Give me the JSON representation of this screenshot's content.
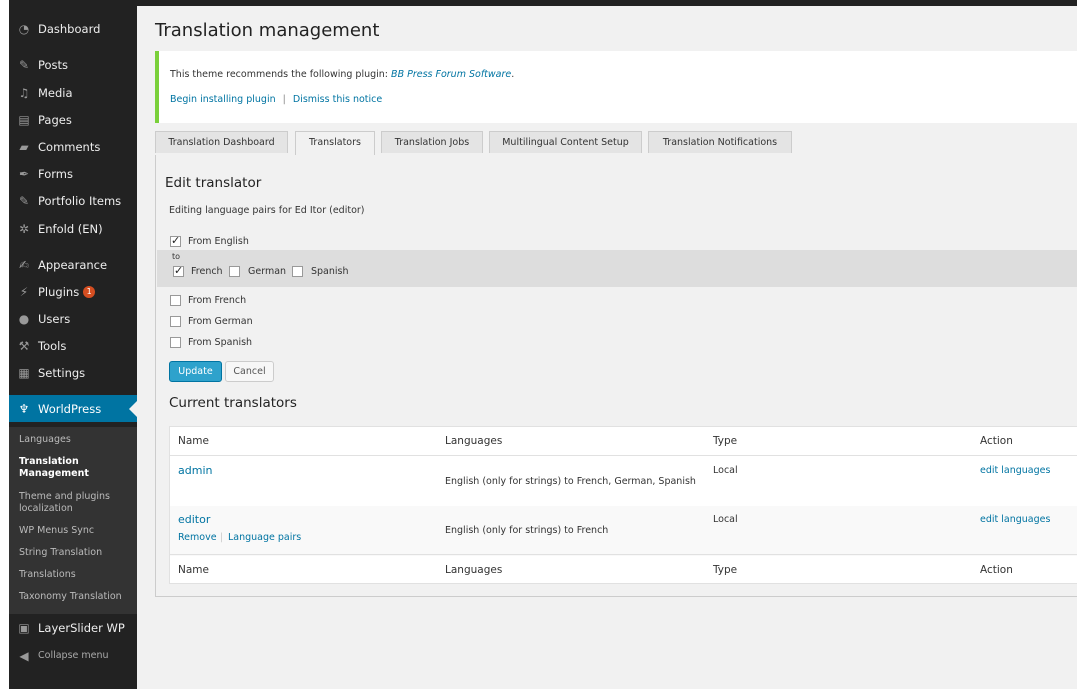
{
  "sidebar": {
    "items": [
      {
        "label": "Dashboard",
        "icon": "dashboard-icon"
      },
      {
        "label": "Posts",
        "icon": "pin-icon"
      },
      {
        "label": "Media",
        "icon": "media-icon"
      },
      {
        "label": "Pages",
        "icon": "pages-icon"
      },
      {
        "label": "Comments",
        "icon": "comment-icon"
      },
      {
        "label": "Forms",
        "icon": "feather-icon"
      },
      {
        "label": "Portfolio Items",
        "icon": "pin-icon"
      },
      {
        "label": "Enfold (EN)",
        "icon": "gear-icon"
      },
      {
        "label": "Appearance",
        "icon": "brush-icon"
      },
      {
        "label": "Plugins",
        "icon": "plug-icon",
        "badge": "1"
      },
      {
        "label": "Users",
        "icon": "user-icon"
      },
      {
        "label": "Tools",
        "icon": "wrench-icon"
      },
      {
        "label": "Settings",
        "icon": "settings-icon"
      },
      {
        "label": "WorldPress",
        "icon": "wpml-icon"
      }
    ],
    "submenu": [
      "Languages",
      "Translation Management",
      "Theme and plugins localization",
      "WP Menus Sync",
      "String Translation",
      "Translations",
      "Taxonomy Translation"
    ],
    "bottom": [
      {
        "label": "LayerSlider WP",
        "icon": "layerslider-icon"
      },
      {
        "label": "Collapse menu",
        "icon": "collapse-icon"
      }
    ]
  },
  "page": {
    "title": "Translation management"
  },
  "notice": {
    "text": "This theme recommends the following plugin:",
    "plugin": "BB Press Forum Software",
    "period": ".",
    "install": "Begin installing plugin",
    "separator": "|",
    "dismiss": "Dismiss this notice"
  },
  "tabs": [
    "Translation Dashboard",
    "Translators",
    "Translation Jobs",
    "Multilingual Content Setup",
    "Translation Notifications"
  ],
  "edit": {
    "heading": "Edit translator",
    "subtitle": "Editing language pairs for Ed Itor (editor)",
    "from_english": "From English",
    "to": "to",
    "french": "French",
    "german": "German",
    "spanish": "Spanish",
    "from_french": "From French",
    "from_german": "From German",
    "from_spanish": "From Spanish",
    "update": "Update",
    "cancel": "Cancel"
  },
  "translators": {
    "heading": "Current translators",
    "columns": [
      "Name",
      "Languages",
      "Type",
      "Action"
    ],
    "rows": [
      {
        "name": "admin",
        "languages": "English (only for strings) to French, German, Spanish",
        "type": "Local",
        "action": "edit languages"
      },
      {
        "name": "editor",
        "languages": "English (only for strings) to French",
        "type": "Local",
        "action": "edit languages",
        "row_actions": [
          "Remove",
          "Language pairs"
        ]
      }
    ]
  },
  "colors": {
    "accent": "#0074a2",
    "notice_border": "#7ad03a",
    "sidebar": "#222222",
    "badge": "#d54e21"
  }
}
